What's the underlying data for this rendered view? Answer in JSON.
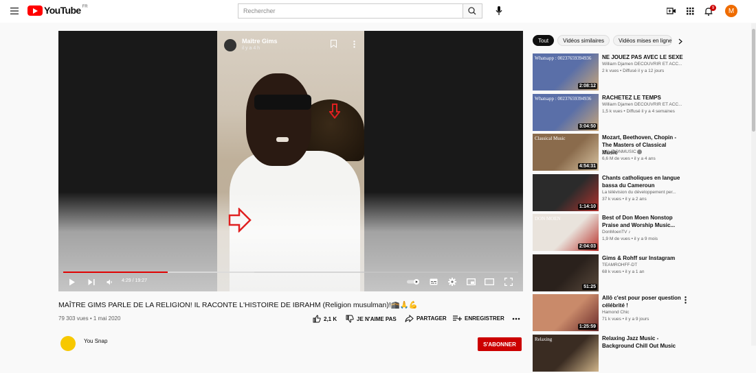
{
  "header": {
    "logo_text": "YouTube",
    "logo_country": "FR",
    "search_placeholder": "Rechercher",
    "notification_count": "9",
    "avatar_letter": "M"
  },
  "player": {
    "overlay_channel": "Maître Gims",
    "overlay_time": "il y a 4 h",
    "time_display": "4:29 / 19:27",
    "progress": 0.23,
    "buffered": 0.42
  },
  "video": {
    "title": "MAÎTRE GIMS PARLE DE LA RELIGION! IL RACONTE L'HISTOIRE DE IBRAHM (Religion musulman)!🕋🙏💪",
    "meta": "79 303 vues • 1 mai 2020",
    "actions": {
      "like": "2,1 K",
      "dislike": "JE N'AIME PAS",
      "share": "PARTAGER",
      "save": "ENREGISTRER"
    },
    "channel_name": "You Snap",
    "subscribe_label": "S'ABONNER"
  },
  "chips": [
    "Tout",
    "Vidéos similaires",
    "Vidéos mises en ligne"
  ],
  "recommendations": [
    {
      "title": "NE JOUEZ PAS AVEC LE SEXE",
      "channel": "William Djamen DÉCOUVRIR ET ACC...",
      "views": "2 k vues • Diffusé il y a 12 jours",
      "duration": "2:08:12",
      "thumb": "#5a6fa8",
      "accent": "#c9a77a",
      "tag": "Whatsapp : 00237659394936"
    },
    {
      "title": "RACHETEZ LE TEMPS",
      "channel": "William Djamen DÉCOUVRIR ET ACC...",
      "views": "1,5 k vues • Diffusé il y a 4 semaines",
      "duration": "3:04:50",
      "thumb": "#5a6fa8",
      "accent": "#c9a77a",
      "tag": "Whatsapp : 00237659394936"
    },
    {
      "title": "Mozart, Beethoven, Chopin - The Masters of Classical Music",
      "channel": "HALIDONMUSIC",
      "views": "6,6 M de vues • il y a 4 ans",
      "duration": "4:54:31",
      "thumb": "#8a6b4c",
      "accent": "#d8c4a2",
      "tag": "Classical Music",
      "verified": true
    },
    {
      "title": "Chants catholiques en langue bassa du Cameroun",
      "channel": "La télévision du développement per...",
      "views": "37 k vues • il y a 2 ans",
      "duration": "1:14:10",
      "thumb": "#2b2b2b",
      "accent": "#b3332e",
      "tag": ""
    },
    {
      "title": "Best of Don Moen Nonstop Praise and Worship Music...",
      "channel": "DonMoenTV ♪",
      "views": "1,9 M de vues • il y a 9 mois",
      "duration": "2:04:03",
      "thumb": "#e9e3dc",
      "accent": "#b8322c",
      "tag": "DON MOEN"
    },
    {
      "title": "Gims & Rohff sur Instagram",
      "channel": "TEAMROHFF-DT",
      "views": "68 k vues • il y a 1 an",
      "duration": "51:25",
      "thumb": "#2a211c",
      "accent": "#5a4a3c",
      "tag": ""
    },
    {
      "title": "Allô c'est pour poser question célébrité !",
      "channel": "Hamond Chic",
      "views": "71 k vues • il y a 9 jours",
      "duration": "1:25:59",
      "thumb": "#c98a6a",
      "accent": "#6a2a2a",
      "tag": ""
    },
    {
      "title": "Relaxing Jazz Music - Background Chill Out Music",
      "channel": "",
      "views": "",
      "duration": "",
      "thumb": "#3a2c22",
      "accent": "#d0b48a",
      "tag": "Relaxing"
    }
  ]
}
